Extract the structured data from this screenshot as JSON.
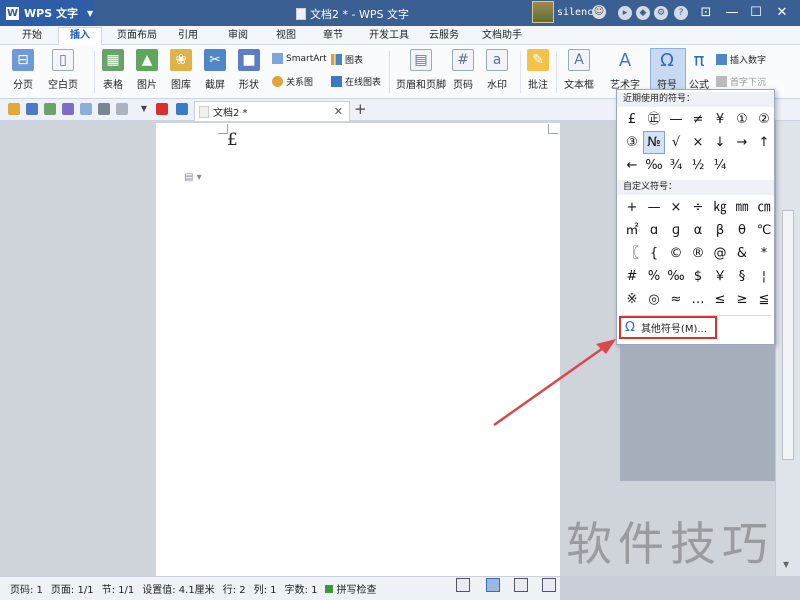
{
  "titlebar": {
    "app_name": "WPS 文字",
    "app_logo": "W",
    "document_title": "文档2 * - WPS 文字",
    "username": "silence"
  },
  "tabs": [
    "开始",
    "插入",
    "页面布局",
    "引用",
    "审阅",
    "视图",
    "章节",
    "开发工具",
    "云服务",
    "文档助手"
  ],
  "active_tab": "插入",
  "ribbon": {
    "page_break": "分页",
    "blank_page": "空白页",
    "table": "表格",
    "picture": "图片",
    "gallery": "图库",
    "screenshot": "截屏",
    "shapes": "形状",
    "smartart": "SmartArt",
    "relation_chart": "关系图",
    "chart": "图表",
    "online_chart": "在线图表",
    "header_footer": "页眉和页脚",
    "page_number": "页码",
    "watermark": "水印",
    "comment": "批注",
    "text_box": "文本框",
    "art_text": "艺术字",
    "symbol": "符号",
    "formula": "公式",
    "insert_number": "插入数字",
    "drop_cap": "首字下沉"
  },
  "document_tab": {
    "label": "文档2 *"
  },
  "document": {
    "inserted_char": "£"
  },
  "symbol_dropdown": {
    "recent_header": "近期使用的符号：",
    "recent_symbols": [
      "£",
      "㊣",
      "—",
      "≠",
      "¥",
      "①",
      "②",
      "③",
      "№",
      "√",
      "×",
      "↓",
      "→",
      "↑",
      "←",
      "‰",
      "¾",
      "½",
      "¼"
    ],
    "custom_header": "自定义符号：",
    "custom_symbols": [
      "+",
      "—",
      "×",
      "÷",
      "㎏",
      "㎜",
      "㎝",
      "㎡",
      "ɑ",
      "ɡ",
      "α",
      "β",
      "θ",
      "℃",
      "〖",
      "{",
      "©",
      "®",
      "@",
      "&",
      "*",
      "#",
      "%",
      "‰",
      "$",
      "￥",
      "§",
      "¦",
      "※",
      "◎",
      "≈",
      "…",
      "≤",
      "≥",
      "≦",
      "≧",
      "□",
      "☑",
      "☒"
    ],
    "more_symbols": "其他符号(M)..."
  },
  "statusbar": {
    "page_num": "页码: 1",
    "pages": "页面: 1/1",
    "section": "节: 1/1",
    "position": "设置值: 4.1厘米",
    "row": "行: 2",
    "column": "列: 1",
    "word_count": "字数: 1",
    "spell_check": "拼写检查"
  },
  "watermark_text": "软件技巧",
  "colors": {
    "title_bar": "#3a5f93",
    "app_button": "#2e5da8",
    "accent": "#1b5cb8",
    "highlight_border": "#d9312b",
    "arrow": "#d9484a"
  }
}
